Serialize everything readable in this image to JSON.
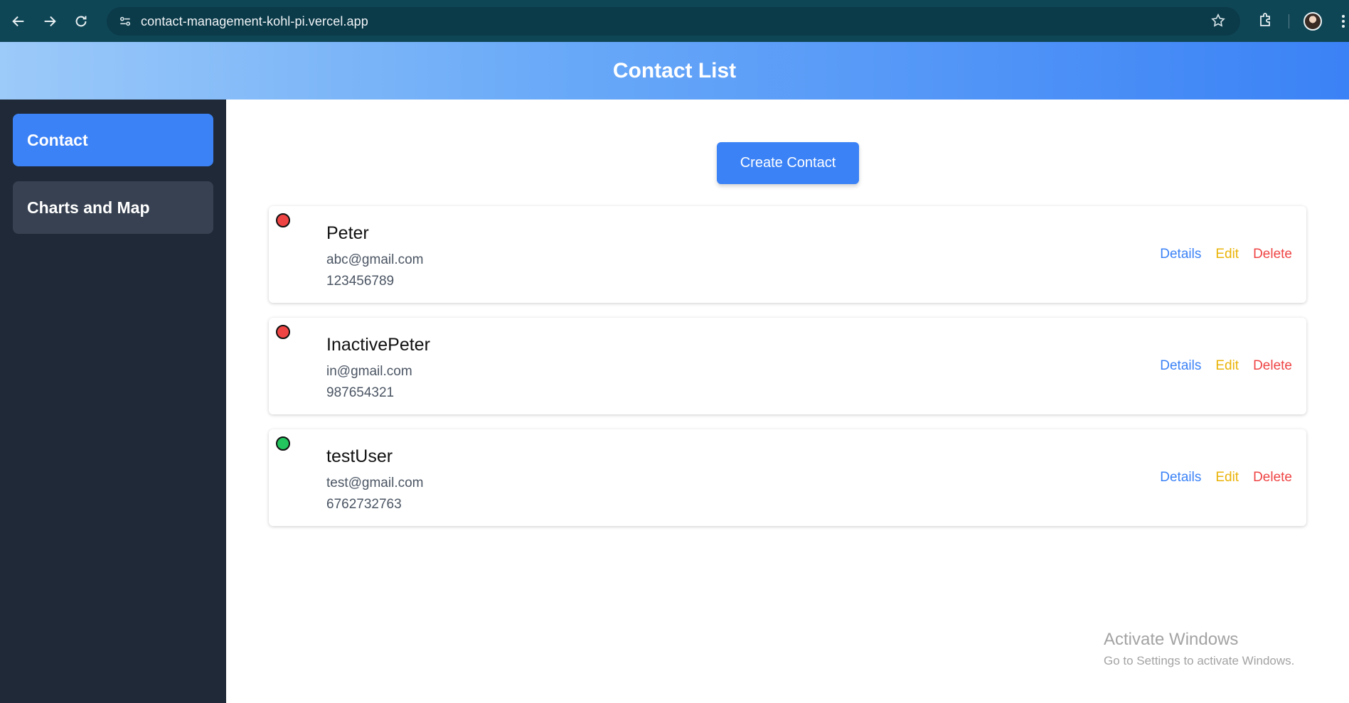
{
  "browser": {
    "url": "contact-management-kohl-pi.vercel.app"
  },
  "header": {
    "title": "Contact List"
  },
  "sidebar": {
    "items": [
      {
        "label": "Contact",
        "active": true
      },
      {
        "label": "Charts and Map",
        "active": false
      }
    ]
  },
  "main": {
    "create_label": "Create Contact",
    "contacts": [
      {
        "name": "Peter",
        "email": "abc@gmail.com",
        "phone": "123456789",
        "status_color": "#ef4444"
      },
      {
        "name": "InactivePeter",
        "email": "in@gmail.com",
        "phone": "987654321",
        "status_color": "#ef4444"
      },
      {
        "name": "testUser",
        "email": "test@gmail.com",
        "phone": "6762732763",
        "status_color": "#22c55e"
      }
    ],
    "actions": {
      "details": "Details",
      "edit": "Edit",
      "delete": "Delete"
    }
  },
  "watermark": {
    "title": "Activate Windows",
    "subtitle": "Go to Settings to activate Windows."
  },
  "colors": {
    "accent": "#3b82f6",
    "sidebar": "#1f2937",
    "edit": "#eab308",
    "delete": "#ef4444"
  }
}
